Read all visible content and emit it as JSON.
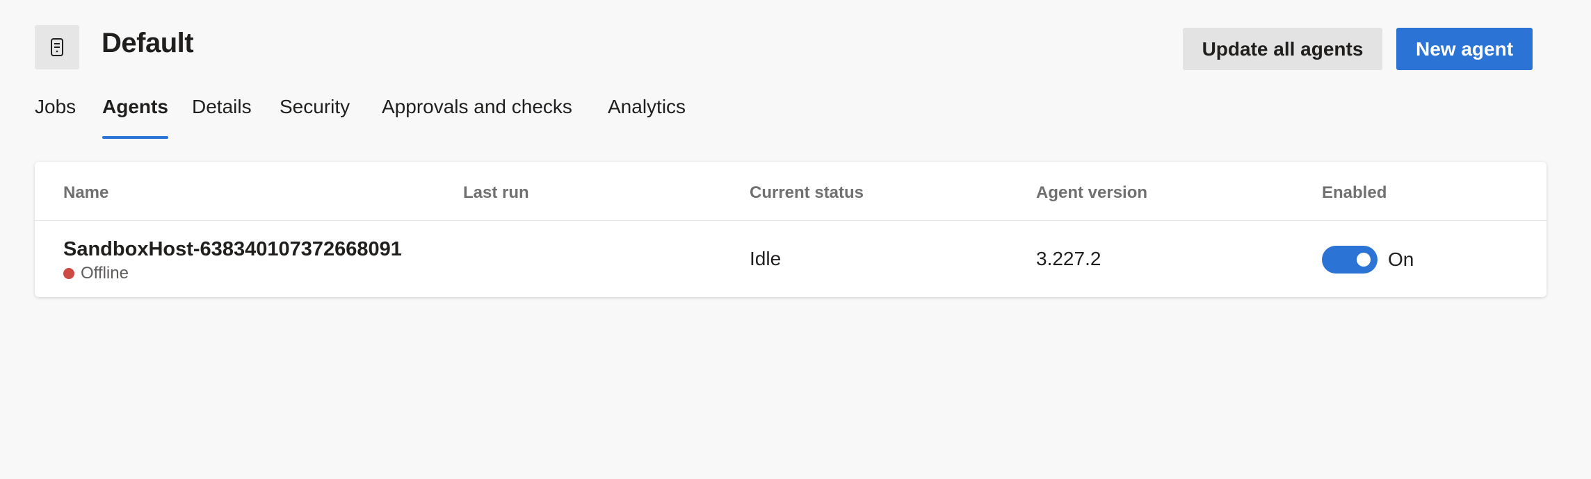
{
  "header": {
    "title": "Default",
    "icon": "agent-device-icon",
    "update_button": "Update all agents",
    "new_button": "New agent"
  },
  "tabs": [
    {
      "label": "Jobs",
      "active": false
    },
    {
      "label": "Agents",
      "active": true
    },
    {
      "label": "Details",
      "active": false
    },
    {
      "label": "Security",
      "active": false
    },
    {
      "label": "Approvals and checks",
      "active": false
    },
    {
      "label": "Analytics",
      "active": false
    }
  ],
  "table": {
    "columns": [
      "Name",
      "Last run",
      "Current status",
      "Agent version",
      "Enabled"
    ],
    "rows": [
      {
        "name": "SandboxHost-638340107372668091",
        "connection": "Offline",
        "last_run": "",
        "status": "Idle",
        "version": "3.227.2",
        "enabled": true,
        "enabled_label": "On"
      }
    ]
  },
  "colors": {
    "accent": "#2b73d4",
    "offline": "#cd4a45",
    "background": "#f8f8f8"
  }
}
